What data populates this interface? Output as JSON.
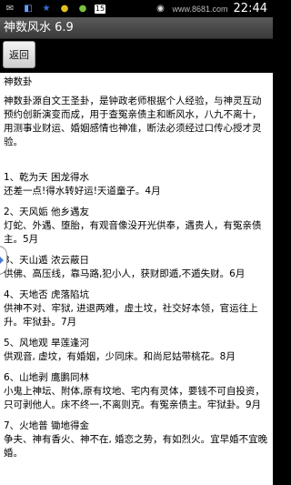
{
  "status_bar": {
    "icons": [
      "sms-icon",
      "app-icon",
      "star-icon",
      "app-icon-2",
      "app-icon-3",
      "battery-level-icon",
      "eye-icon",
      "wifi-icon",
      "signal-icon"
    ],
    "battery_label": "15",
    "site_text": "www.8681.com",
    "time": "22:44"
  },
  "title_bar": {
    "title": "神数风水 6.9"
  },
  "back_button": {
    "label": "返回"
  },
  "content": {
    "heading": "神数卦",
    "intro": "神数卦源自文王圣卦，是钟政老师根据个人经验，与神灵互动预约创新演变而成，用于查冤亲债主和断风水，八九不离十，用测事业财运、婚姻感情也神准，断法必须经过口传心授才灵验。",
    "entries": [
      {
        "title": "1、乾为天 困龙得水",
        "body": "还差一点!得水转好运!天道童子。4月"
      },
      {
        "title": "2、天风姤 他乡遇友",
        "body": "灯蛇、外遇、堕胎，有观音像没开光供奉，遇贵人，有冤亲债主。5月"
      },
      {
        "title": "3、天山遁 浓云蔽日",
        "body": "供佛、高压线，靠马路,犯小人，获财即遁,不遁失财。6月"
      },
      {
        "title": "4、天地否 虎落陷坑",
        "body": "供神不对、牢狱, 进退两难，虚土坟，社交好本领，官运往上升。牢狱卦。7月"
      },
      {
        "title": "5、风地观 旱莲逢河",
        "body": "供观音, 虚坟，有婚姻，少同床。和尚尼姑带桃花。8月"
      },
      {
        "title": "6、山地剥 鹰鹏同林",
        "body": "小鬼上神坛、附体,原有坟地、宅内有灵体，要钱不可自投资，只可剥他人。床不终一,不离则克。有冤亲债主。牢狱卦。9月"
      },
      {
        "title": "7、火地普 锄地得金",
        "body": "争夫、神有香火、神不在, 婚恋之势，有如烈火。宜早婚不宜晚婚。"
      }
    ]
  }
}
